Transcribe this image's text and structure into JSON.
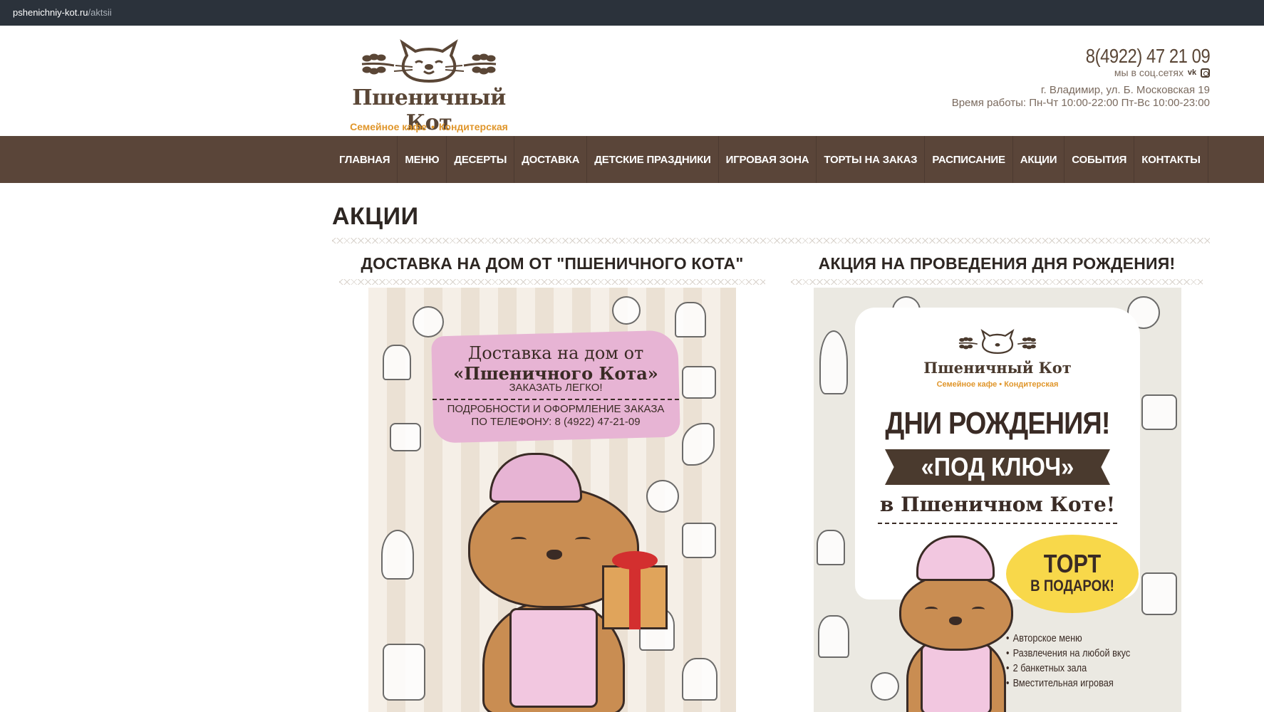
{
  "browser": {
    "url_host": "pshenichniy-kot.ru",
    "url_path": "/aktsii"
  },
  "header": {
    "logo_name": "Пшеничный Кот",
    "logo_tag_left": "Семейное кафе",
    "logo_tag_sep": "•",
    "logo_tag_right": "Кондитерская",
    "phone": "8(4922) 47 21 09",
    "social_label": "мы в соц.сетях",
    "social_icons": [
      "vk-icon",
      "instagram-icon"
    ],
    "address": "г. Владимир, ул. Б. Московская 19",
    "hours": "Время работы: Пн-Чт 10:00-22:00 Пт-Вс 10:00-23:00"
  },
  "nav": {
    "items": [
      "ГЛАВНАЯ",
      "МЕНЮ",
      "ДЕСЕРТЫ",
      "ДОСТАВКА",
      "ДЕТСКИЕ ПРАЗДНИКИ",
      "ИГРОВАЯ ЗОНА",
      "ТОРТЫ НА ЗАКАЗ",
      "РАСПИСАНИЕ",
      "АКЦИИ",
      "СОБЫТИЯ",
      "КОНТАКТЫ"
    ]
  },
  "main": {
    "page_title": "АКЦИИ",
    "cards": [
      {
        "title": "ДОСТАВКА НА ДОМ ОТ \"ПШЕНИЧНОГО КОТА\"",
        "banner_line1": "Доставка на дом от",
        "banner_line2": "«Пшеничного Кота»",
        "banner_line3": "ЗАКАЗАТЬ ЛЕГКО!",
        "banner_line4": "ПОДРОБНОСТИ И ОФОРМЛЕНИЕ ЗАКАЗА",
        "banner_line5": "ПО ТЕЛЕФОНУ: 8 (4922) 47-21-09"
      },
      {
        "title": "АКЦИЯ НА ПРОВЕДЕНИЯ ДНЯ РОЖДЕНИЯ!",
        "logo_name": "Пшеничный Кот",
        "logo_tag": "Семейное кафе • Кондитерская",
        "big": "ДНИ РОЖДЕНИЯ!",
        "ribbon": "«ПОД КЛЮЧ»",
        "small": "в Пшеничном Коте!",
        "badge_line1": "ТОРТ",
        "badge_line2": "В ПОДАРОК!",
        "list": [
          "Авторское меню",
          "Развлечения на любой вкус",
          "2 банкетных зала",
          "Вместительная игровая"
        ]
      }
    ]
  },
  "colors": {
    "nav_bg": "#5a4539",
    "accent_orange": "#e0962b",
    "brand_brown": "#5a4636",
    "pink": "#e7b4d4",
    "yellow": "#f8d84a"
  }
}
